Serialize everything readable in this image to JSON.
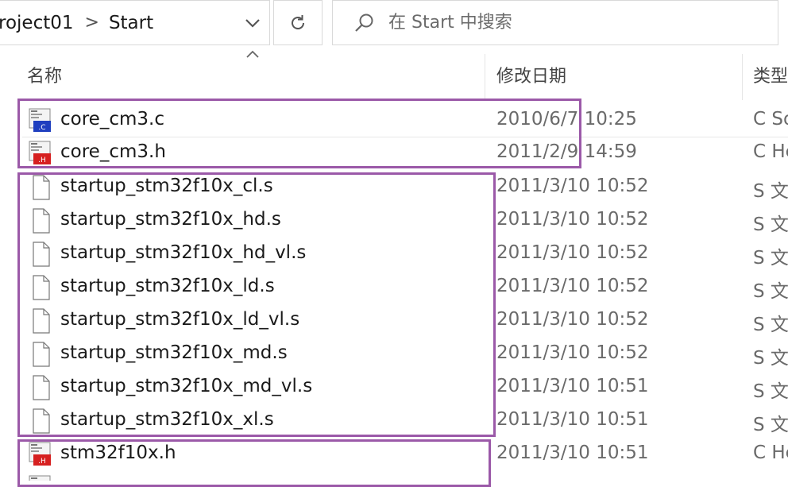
{
  "address_bar": {
    "path": [
      "roject01",
      "Start"
    ],
    "separator": ">"
  },
  "search": {
    "placeholder": "在 Start 中搜索"
  },
  "columns": {
    "name": "名称",
    "date_modified": "修改日期",
    "type": "类型"
  },
  "files": [
    {
      "name": "core_cm3.c",
      "date": "2010/6/7 10:25",
      "type": "C So",
      "icon": "c-source-file-icon"
    },
    {
      "name": "core_cm3.h",
      "date": "2011/2/9 14:59",
      "type": "C He",
      "icon": "c-header-file-icon"
    },
    {
      "name": "startup_stm32f10x_cl.s",
      "date": "2011/3/10 10:52",
      "type": "S 文",
      "icon": "blank-file-icon"
    },
    {
      "name": "startup_stm32f10x_hd.s",
      "date": "2011/3/10 10:52",
      "type": "S 文",
      "icon": "blank-file-icon"
    },
    {
      "name": "startup_stm32f10x_hd_vl.s",
      "date": "2011/3/10 10:52",
      "type": "S 文",
      "icon": "blank-file-icon"
    },
    {
      "name": "startup_stm32f10x_ld.s",
      "date": "2011/3/10 10:52",
      "type": "S 文",
      "icon": "blank-file-icon"
    },
    {
      "name": "startup_stm32f10x_ld_vl.s",
      "date": "2011/3/10 10:52",
      "type": "S 文",
      "icon": "blank-file-icon"
    },
    {
      "name": "startup_stm32f10x_md.s",
      "date": "2011/3/10 10:52",
      "type": "S 文",
      "icon": "blank-file-icon"
    },
    {
      "name": "startup_stm32f10x_md_vl.s",
      "date": "2011/3/10 10:51",
      "type": "S 文",
      "icon": "blank-file-icon"
    },
    {
      "name": "startup_stm32f10x_xl.s",
      "date": "2011/3/10 10:51",
      "type": "S 文",
      "icon": "blank-file-icon"
    },
    {
      "name": "stm32f10x.h",
      "date": "2011/3/10 10:51",
      "type": "C He",
      "icon": "c-header-file-icon"
    }
  ],
  "colors": {
    "highlight_box": "#9b59a8",
    "c_source_badge": "#1f3fbf",
    "c_header_badge": "#d62020"
  }
}
